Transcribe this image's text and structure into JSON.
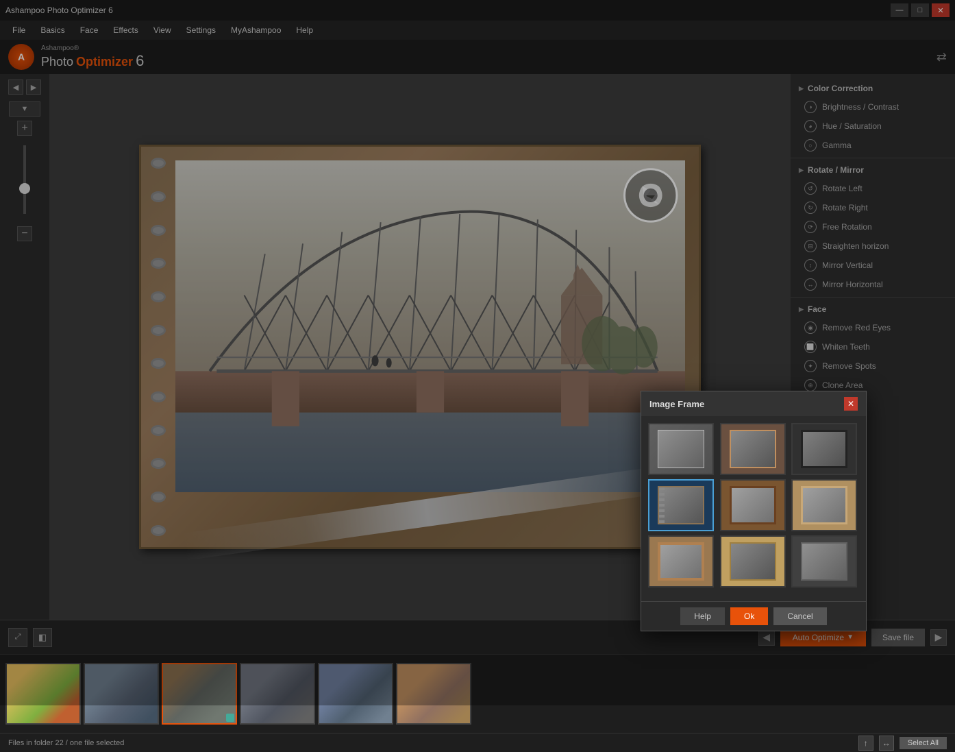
{
  "titleBar": {
    "title": "Ashampoo Photo Optimizer 6",
    "minBtn": "—",
    "maxBtn": "□",
    "closeBtn": "✕"
  },
  "menuBar": {
    "items": [
      "File",
      "Basics",
      "Face",
      "Effects",
      "View",
      "Settings",
      "MyAshampoo",
      "Help"
    ]
  },
  "appHeader": {
    "logoText": "A",
    "appNamePrefix": "Ashampoo®",
    "appNameMain": "Photo",
    "appNameSub": "Optimizer",
    "version": "6"
  },
  "rightPanel": {
    "sections": [
      {
        "header": "Color Correction",
        "items": [
          "Brightness / Contrast",
          "Hue / Saturation",
          "Gamma"
        ]
      },
      {
        "header": "Rotate / Mirror",
        "items": [
          "Rotate Left",
          "Rotate Right",
          "Free Rotation",
          "Straighten horizon",
          "Mirror Vertical",
          "Mirror Horizontal"
        ]
      },
      {
        "header": "Face",
        "items": [
          "Remove Red Eyes",
          "Whiten Teeth",
          "Remove Spots",
          "Clone Area"
        ]
      }
    ]
  },
  "toolbar": {
    "expandLabel": "⤢",
    "previewLabel": "◧",
    "prevArrow": "◀",
    "autoOptimizeLabel": "Auto Optimize",
    "autoOptimizeArrow": "▼",
    "saveLabel": "Save file",
    "nextArrow": "▶"
  },
  "statusBar": {
    "text": "Files in folder 22 / one file selected",
    "selectAllLabel": "Select All"
  },
  "imageFrameDialog": {
    "title": "Image Frame",
    "closeBtn": "✕",
    "helpLabel": "Help",
    "okLabel": "Ok",
    "cancelLabel": "Cancel",
    "frames": [
      {
        "id": "frame-plain",
        "style": "plain"
      },
      {
        "id": "frame-torn",
        "style": "torn"
      },
      {
        "id": "frame-dark-border",
        "style": "dark-border"
      },
      {
        "id": "frame-notebook",
        "style": "notebook",
        "selected": true
      },
      {
        "id": "frame-wood",
        "style": "wood"
      },
      {
        "id": "frame-light",
        "style": "light"
      },
      {
        "id": "frame-dark2",
        "style": "dark2"
      },
      {
        "id": "frame-brown",
        "style": "brown"
      },
      {
        "id": "frame-stripe",
        "style": "stripe"
      }
    ]
  }
}
